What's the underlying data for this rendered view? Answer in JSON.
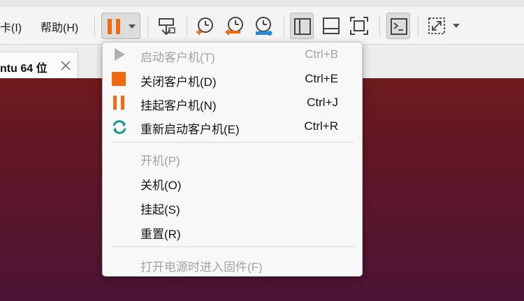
{
  "menubar": {
    "card_menu": "卡(I)",
    "help_menu": "帮助(H)"
  },
  "tab": {
    "title": "ntu 64 位"
  },
  "colors": {
    "accent_orange": "#f06a10",
    "restart_teal": "#1a9a8a",
    "snapshot_blue": "#2a8ad6"
  },
  "power_menu": {
    "items": [
      {
        "label": "启动客户机(T)",
        "shortcut": "Ctrl+B",
        "enabled": false,
        "icon": "play-icon"
      },
      {
        "label": "关闭客户机(D)",
        "shortcut": "Ctrl+E",
        "enabled": true,
        "icon": "stop-icon"
      },
      {
        "label": "挂起客户机(N)",
        "shortcut": "Ctrl+J",
        "enabled": true,
        "icon": "pause-icon"
      },
      {
        "label": "重新启动客户机(E)",
        "shortcut": "Ctrl+R",
        "enabled": true,
        "icon": "restart-icon"
      },
      {
        "label": "开机(P)",
        "shortcut": "",
        "enabled": false
      },
      {
        "label": "关机(O)",
        "shortcut": "",
        "enabled": true
      },
      {
        "label": "挂起(S)",
        "shortcut": "",
        "enabled": true
      },
      {
        "label": "重置(R)",
        "shortcut": "",
        "enabled": true
      },
      {
        "label": "打开电源时进入固件(F)",
        "shortcut": "",
        "enabled": false
      }
    ]
  }
}
